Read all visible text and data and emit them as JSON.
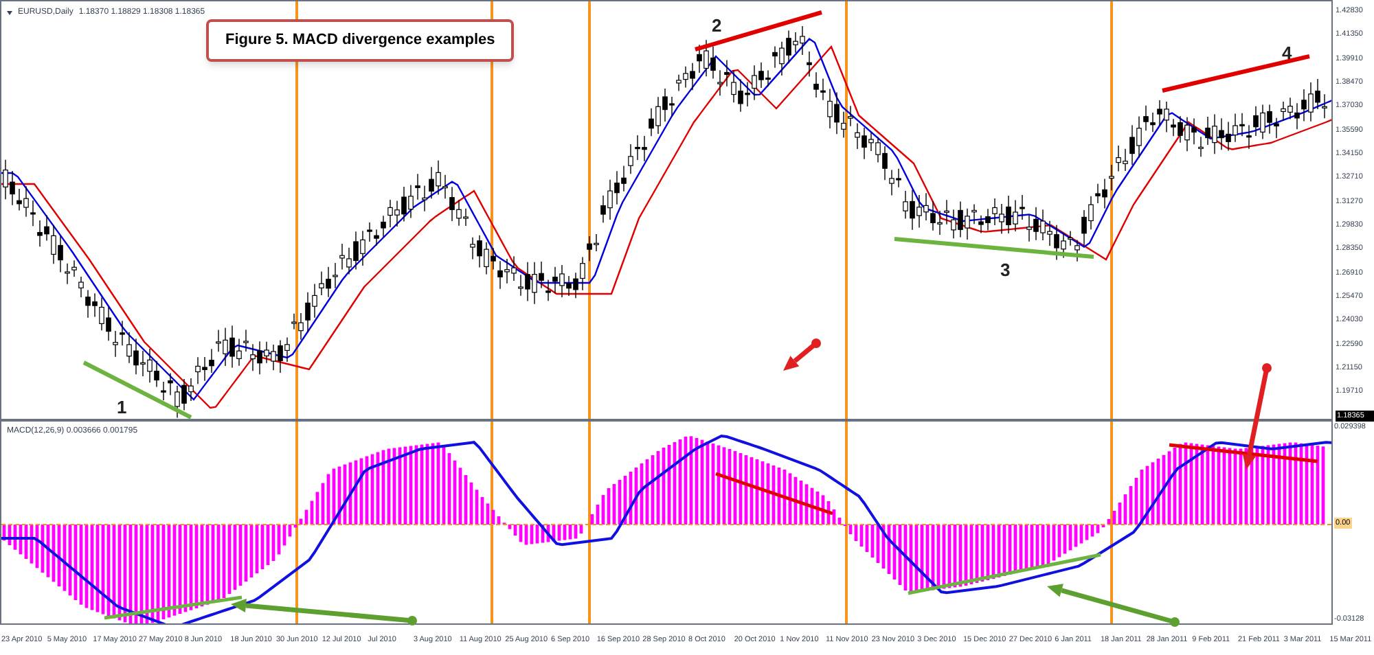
{
  "chart_header": {
    "symbol": "EURUSD,Daily",
    "quotes": "1.18370 1.18829 1.18308 1.18365"
  },
  "figure_title": "Figure 5. MACD divergence examples",
  "annotations": [
    "1",
    "2",
    "3",
    "4"
  ],
  "price_axis": {
    "ticks": [
      "1.42830",
      "1.41350",
      "1.39910",
      "1.38470",
      "1.37030",
      "1.35590",
      "1.34150",
      "1.32710",
      "1.31270",
      "1.29830",
      "1.28350",
      "1.26910",
      "1.25470",
      "1.24030",
      "1.22590",
      "1.21150",
      "1.19710"
    ],
    "current_price": "1.18365"
  },
  "macd_panel": {
    "label": "MACD(12,26,9) 0.003666 0.001795",
    "top_tick": "0.029398",
    "zero_tick": "0.00",
    "bottom_tick": "-0.03128"
  },
  "date_axis": [
    "23 Apr 2010",
    "5 May 2010",
    "17 May 2010",
    "27 May 2010",
    "8 Jun 2010",
    "18 Jun 2010",
    "30 Jun 2010",
    "12 Jul 2010",
    "Jul 2010",
    "3 Aug 2010",
    "11 Aug 2010",
    "25 Aug 2010",
    "6 Sep 2010",
    "16 Sep 2010",
    "28 Sep 2010",
    "8 Oct 2010",
    "20 Oct 2010",
    "1 Nov 2010",
    "11 Nov 2010",
    "23 Nov 2010",
    "3 Dec 2010",
    "15 Dec 2010",
    "27 Dec 2010",
    "6 Jan 2011",
    "18 Jan 2011",
    "28 Jan 2011",
    "9 Feb 2011",
    "21 Feb 2011",
    "3 Mar 2011",
    "15 Mar 2011"
  ]
}
